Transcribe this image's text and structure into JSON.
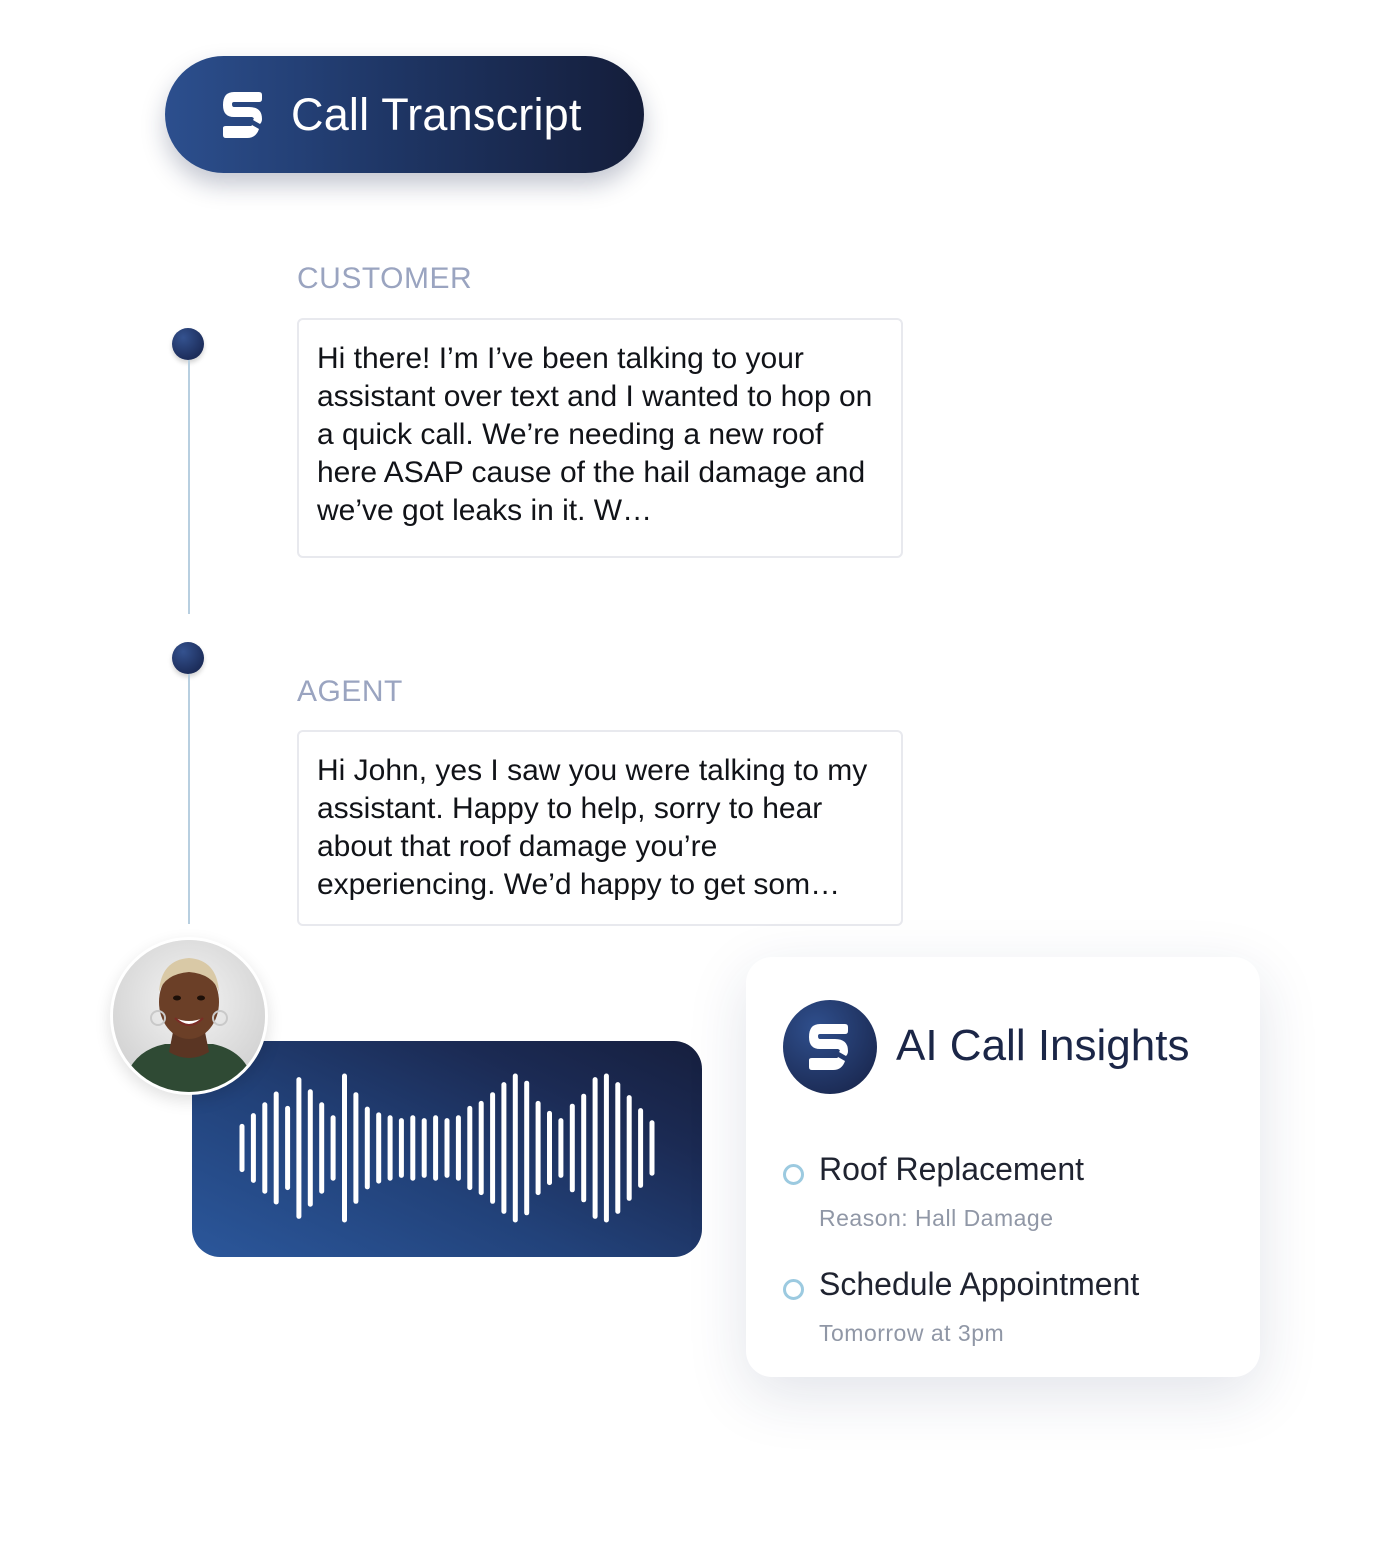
{
  "header": {
    "title": "Call Transcript",
    "logo_icon": "s-logo-icon"
  },
  "transcript": [
    {
      "role": "CUSTOMER",
      "message": "Hi there! I’m I’ve been talking to your assistant over text and I wanted to hop on a quick call. We’re needing a new roof here ASAP cause of the hail damage and we’ve got leaks in it. W…"
    },
    {
      "role": "AGENT",
      "message": "Hi John, yes I saw you were talking to my assistant. Happy to help, sorry to hear about that roof damage you’re experiencing. We’d happy to get som…"
    }
  ],
  "call_audio": {
    "avatar_icon": "agent-avatar",
    "waveform_icon": "audio-waveform-icon",
    "waveform_levels": [
      0.3,
      0.45,
      0.6,
      0.75,
      0.55,
      0.95,
      0.78,
      0.6,
      0.42,
      1.0,
      0.74,
      0.54,
      0.46,
      0.42,
      0.38,
      0.42,
      0.38,
      0.42,
      0.38,
      0.42,
      0.55,
      0.62,
      0.74,
      0.88,
      1.0,
      0.9,
      0.62,
      0.48,
      0.38,
      0.58,
      0.72,
      0.95,
      1.0,
      0.88,
      0.7,
      0.52,
      0.35
    ]
  },
  "insights": {
    "title": "AI Call Insights",
    "logo_icon": "s-logo-icon",
    "items": [
      {
        "label": "Roof Replacement",
        "detail": "Reason: Hall Damage"
      },
      {
        "label": "Schedule Appointment",
        "detail": "Tomorrow at 3pm"
      }
    ]
  },
  "colors": {
    "brand_navy": "#1b2647",
    "brand_blue": "#2c4f8e",
    "role_label": "#9aa4c0",
    "timeline_line": "#b8cfe0",
    "insight_ring": "#9ccae0"
  }
}
